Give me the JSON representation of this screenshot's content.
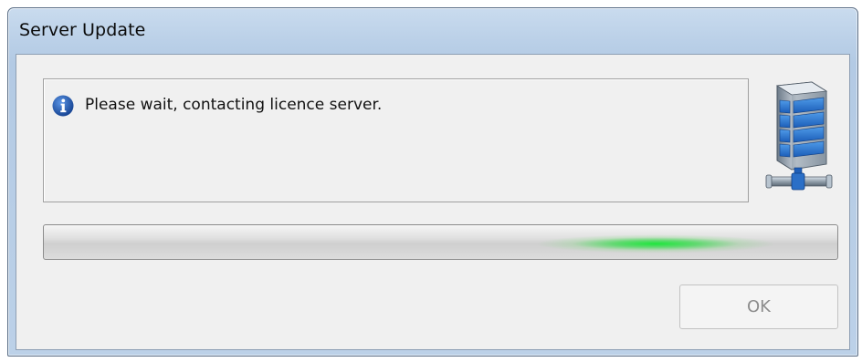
{
  "window": {
    "title": "Server Update"
  },
  "message": {
    "icon": "info-icon",
    "text": "Please wait, contacting licence server."
  },
  "server_icon": "server-network-icon",
  "progress": {
    "mode": "indeterminate marquee",
    "color": "#22dd44"
  },
  "buttons": {
    "ok_label": "OK",
    "ok_state": "disabled"
  },
  "colors": {
    "titlebar": "#b9cfe7",
    "client_background": "#f0f0f0",
    "info_icon": "#1f5fb8"
  }
}
